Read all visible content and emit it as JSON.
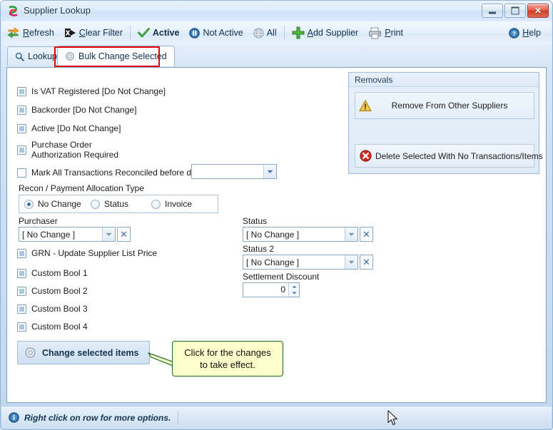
{
  "window": {
    "title": "Supplier Lookup",
    "icon": "app-swirl-icon",
    "minimize": "–",
    "maximize": "□",
    "close": "✕"
  },
  "toolbar": {
    "items": [
      {
        "id": "refresh",
        "label": "Refresh",
        "accel": "R",
        "icon": "refresh-icon",
        "bold": false
      },
      {
        "id": "clear-filter",
        "label": "Clear Filter",
        "accel": "C",
        "icon": "clear-filter-icon",
        "bold": false
      },
      {
        "id": "active",
        "label": "Active",
        "accel": "",
        "icon": "green-check-icon",
        "bold": true
      },
      {
        "id": "not-active",
        "label": "Not Active",
        "accel": "",
        "icon": "pause-icon",
        "bold": false
      },
      {
        "id": "all",
        "label": "All",
        "accel": "",
        "icon": "globe-icon",
        "bold": false
      },
      {
        "id": "add-supplier",
        "label": "Add Supplier",
        "accel": "A",
        "icon": "green-plus-icon",
        "bold": false
      },
      {
        "id": "print",
        "label": "Print",
        "accel": "P",
        "icon": "printer-icon",
        "bold": false
      },
      {
        "id": "help",
        "label": "Help",
        "accel": "H",
        "icon": "help-icon",
        "bold": false
      }
    ]
  },
  "tabs": [
    {
      "id": "lookup",
      "label": "Lookup",
      "icon": "magnifier-icon",
      "active": false
    },
    {
      "id": "bulk-change-selected",
      "label": "Bulk Change Selected",
      "icon": "gear-icon",
      "active": true
    }
  ],
  "form": {
    "checkboxes": [
      {
        "id": "is-vat-registered",
        "label": "Is VAT Registered [Do Not Change]",
        "state": "indeterminate"
      },
      {
        "id": "backorder",
        "label": "Backorder [Do Not Change]",
        "state": "indeterminate"
      },
      {
        "id": "active",
        "label": "Active [Do Not Change]",
        "state": "indeterminate"
      },
      {
        "id": "po-auth-required",
        "label": "Purchase Order\nAuthorization Required",
        "state": "indeterminate"
      },
      {
        "id": "mark-reconciled",
        "label": "Mark All Transactions Reconciled before date:",
        "state": "unchecked"
      }
    ],
    "date_field": {
      "label": "",
      "value": "",
      "placeholder": ""
    },
    "recon_group": {
      "label": "Recon / Payment Allocation Type",
      "options": [
        {
          "id": "no-change",
          "label": "No Change",
          "selected": true
        },
        {
          "id": "status",
          "label": "Status",
          "selected": false
        },
        {
          "id": "invoice",
          "label": "Invoice",
          "selected": false
        }
      ]
    },
    "purchaser": {
      "label": "Purchaser",
      "value": "[ No Change ]"
    },
    "grn_checkbox": {
      "label": "GRN - Update Supplier List Price",
      "state": "indeterminate"
    },
    "custom_bools": [
      {
        "id": "custom-bool-1",
        "label": "Custom Bool 1",
        "state": "indeterminate"
      },
      {
        "id": "custom-bool-2",
        "label": "Custom Bool 2",
        "state": "indeterminate"
      },
      {
        "id": "custom-bool-3",
        "label": "Custom Bool 3",
        "state": "indeterminate"
      },
      {
        "id": "custom-bool-4",
        "label": "Custom Bool 4",
        "state": "indeterminate"
      }
    ],
    "status": {
      "label": "Status",
      "value": "[ No Change ]"
    },
    "status2": {
      "label": "Status 2",
      "value": "[ No Change ]"
    },
    "settlement_discount": {
      "label": "Settlement Discount",
      "value": "0"
    },
    "change_button": {
      "label": "Change selected items",
      "icon": "gear-icon"
    },
    "clear_glyph": "✕",
    "arrow_glyph": "▼"
  },
  "removals": {
    "title": "Removals",
    "buttons": [
      {
        "id": "remove-from-other-suppliers",
        "label": "Remove From Other Suppliers",
        "icon": "warning-icon",
        "align": "center"
      },
      {
        "id": "delete-selected-no-transactions",
        "label": "Delete Selected With No Transactions/Items",
        "icon": "error-icon",
        "align": "left"
      }
    ]
  },
  "callout": {
    "line1": "Click for the changes",
    "line2": "to take effect."
  },
  "statusbar": {
    "hint": "Right click on row for more options.",
    "icon": "info-icon"
  },
  "colors": {
    "accent": "#3a6ea5",
    "window_border": "#8fb4d9",
    "highlight_red": "#e00000",
    "callout_bg": "#ffffcc",
    "callout_border": "#1e6b1e",
    "checkbox_fill": "#a9c6e3"
  }
}
